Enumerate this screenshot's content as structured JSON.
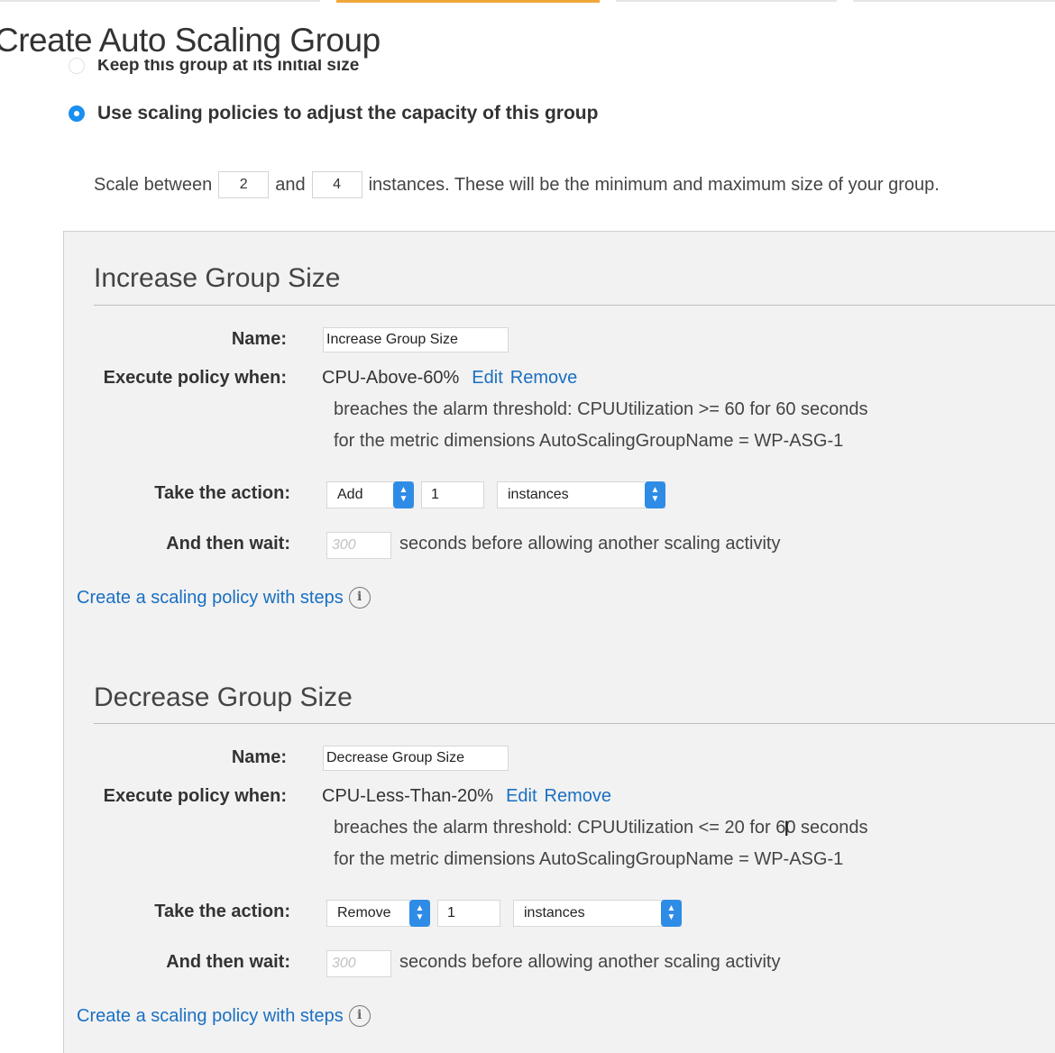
{
  "page": {
    "title": "Create Auto Scaling Group"
  },
  "size_options": {
    "keep_label": "Keep this group at its initial size",
    "use_policies_label": "Use scaling policies to adjust the capacity of this group",
    "selected": "use_policies"
  },
  "scale": {
    "prefix": "Scale between",
    "min": "2",
    "conjunction": "and",
    "max": "4",
    "suffix": "instances. These will be the minimum and maximum size of your group."
  },
  "labels": {
    "name": "Name:",
    "execute_when": "Execute policy when:",
    "take_action": "Take the action:",
    "then_wait": "And then wait:",
    "wait_suffix": "seconds before allowing another scaling activity",
    "edit": "Edit",
    "remove": "Remove",
    "steps_link": "Create a scaling policy with steps",
    "info_glyph": "i"
  },
  "increase": {
    "section_title": "Increase Group Size",
    "name": "Increase Group Size",
    "alarm": "CPU-Above-60%",
    "threshold": "breaches the alarm threshold: CPUUtilization >= 60 for 60 seconds",
    "dimensions": "for the metric dimensions AutoScalingGroupName = WP-ASG-1",
    "action": "Add",
    "amount": "1",
    "unit": "instances",
    "wait_placeholder": "300"
  },
  "decrease": {
    "section_title": "Decrease Group Size",
    "name": "Decrease Group Size",
    "alarm": "CPU-Less-Than-20%",
    "threshold": "breaches the alarm threshold: CPUUtilization <= 20 for 60 seconds",
    "dimensions": "for the metric dimensions AutoScalingGroupName = WP-ASG-1",
    "action": "Remove",
    "amount": "1",
    "unit": "instances",
    "wait_placeholder": "300"
  },
  "colors": {
    "accent": "#1a8ff0",
    "link": "#1a6fc2",
    "select_arrows": "#2f8ce6",
    "wizard_active_tab": "#f0a73a",
    "panel_background": "#f2f2f2"
  },
  "icons": {
    "info": "info-icon",
    "select_arrows": "up-down-arrows-icon",
    "text_cursor": "ibeam-cursor-icon"
  }
}
